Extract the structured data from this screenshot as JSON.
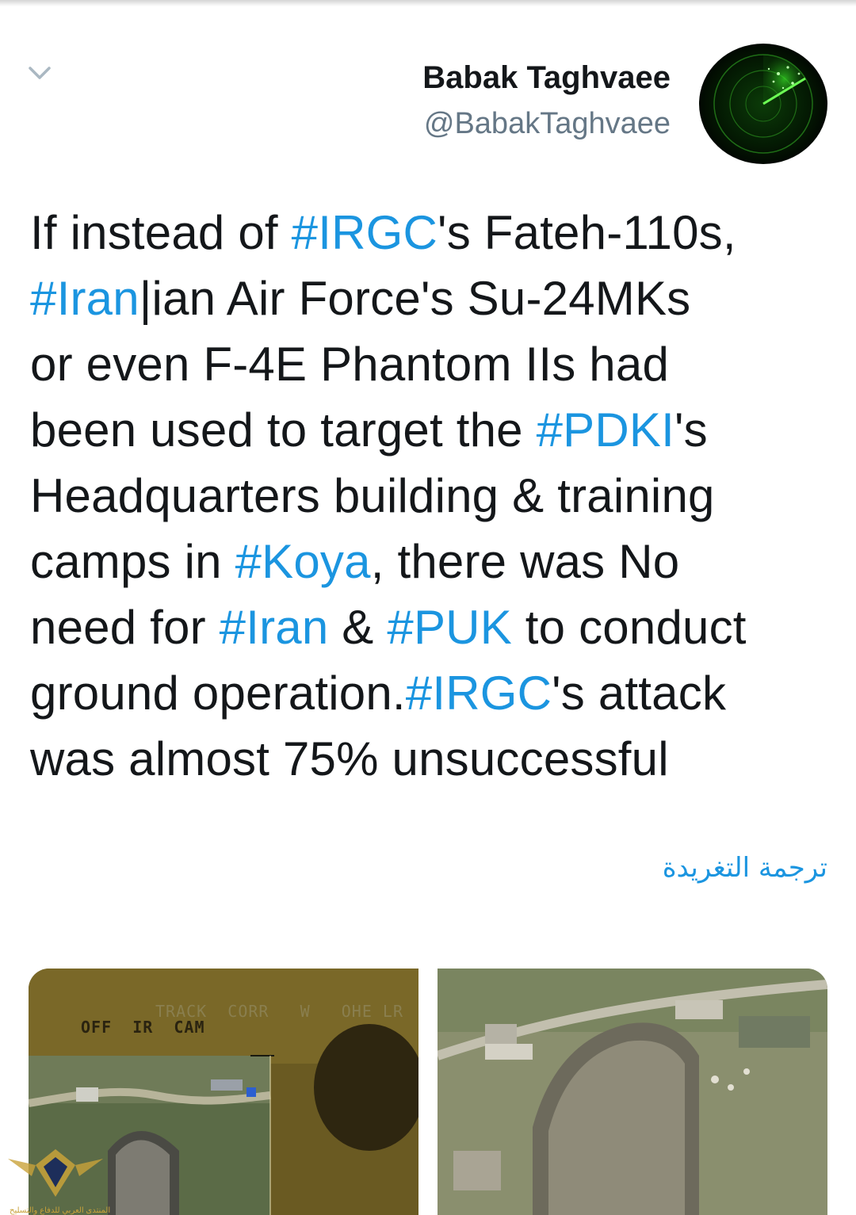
{
  "author": {
    "display_name": "Babak Taghvaee",
    "handle": "@BabakTaghvaee"
  },
  "menu": {
    "icon": "chevron-down-icon"
  },
  "avatar": {
    "icon": "radar-avatar"
  },
  "tweet": {
    "lines": [
      [
        {
          "t": "If instead of "
        },
        {
          "t": "#IRGC",
          "h": true
        },
        {
          "t": "'s Fateh-110s,"
        }
      ],
      [
        {
          "t": "#Iran",
          "h": true
        },
        {
          "t": "|ian Air Force's Su-24MKs"
        }
      ],
      [
        {
          "t": "or even F-4E Phantom IIs had"
        }
      ],
      [
        {
          "t": "been used to target the "
        },
        {
          "t": "#PDKI",
          "h": true
        },
        {
          "t": "'s"
        }
      ],
      [
        {
          "t": "Headquarters building & training"
        }
      ],
      [
        {
          "t": "camps in "
        },
        {
          "t": "#Koya",
          "h": true
        },
        {
          "t": ", there was No"
        }
      ],
      [
        {
          "t": "need for "
        },
        {
          "t": "#Iran",
          "h": true
        },
        {
          "t": " & "
        },
        {
          "t": "#PUK",
          "h": true
        },
        {
          "t": " to conduct"
        }
      ],
      [
        {
          "t": "ground operation."
        },
        {
          "t": "#IRGC",
          "h": true
        },
        {
          "t": "'s attack"
        }
      ],
      [
        {
          "t": "was almost 75% unsuccessful"
        }
      ]
    ]
  },
  "translate_label": "ترجمة التغريدة",
  "media": {
    "left_overlay": {
      "line1": "TRACK  CORR   W   OHE LR",
      "line2": "OFF  IR  CAM"
    }
  },
  "colors": {
    "hashtag": "#1b95e0",
    "text": "#14171a",
    "secondary": "#657786"
  },
  "watermark": {
    "label": "المنتدى العربي للدفاع والتسليح"
  }
}
